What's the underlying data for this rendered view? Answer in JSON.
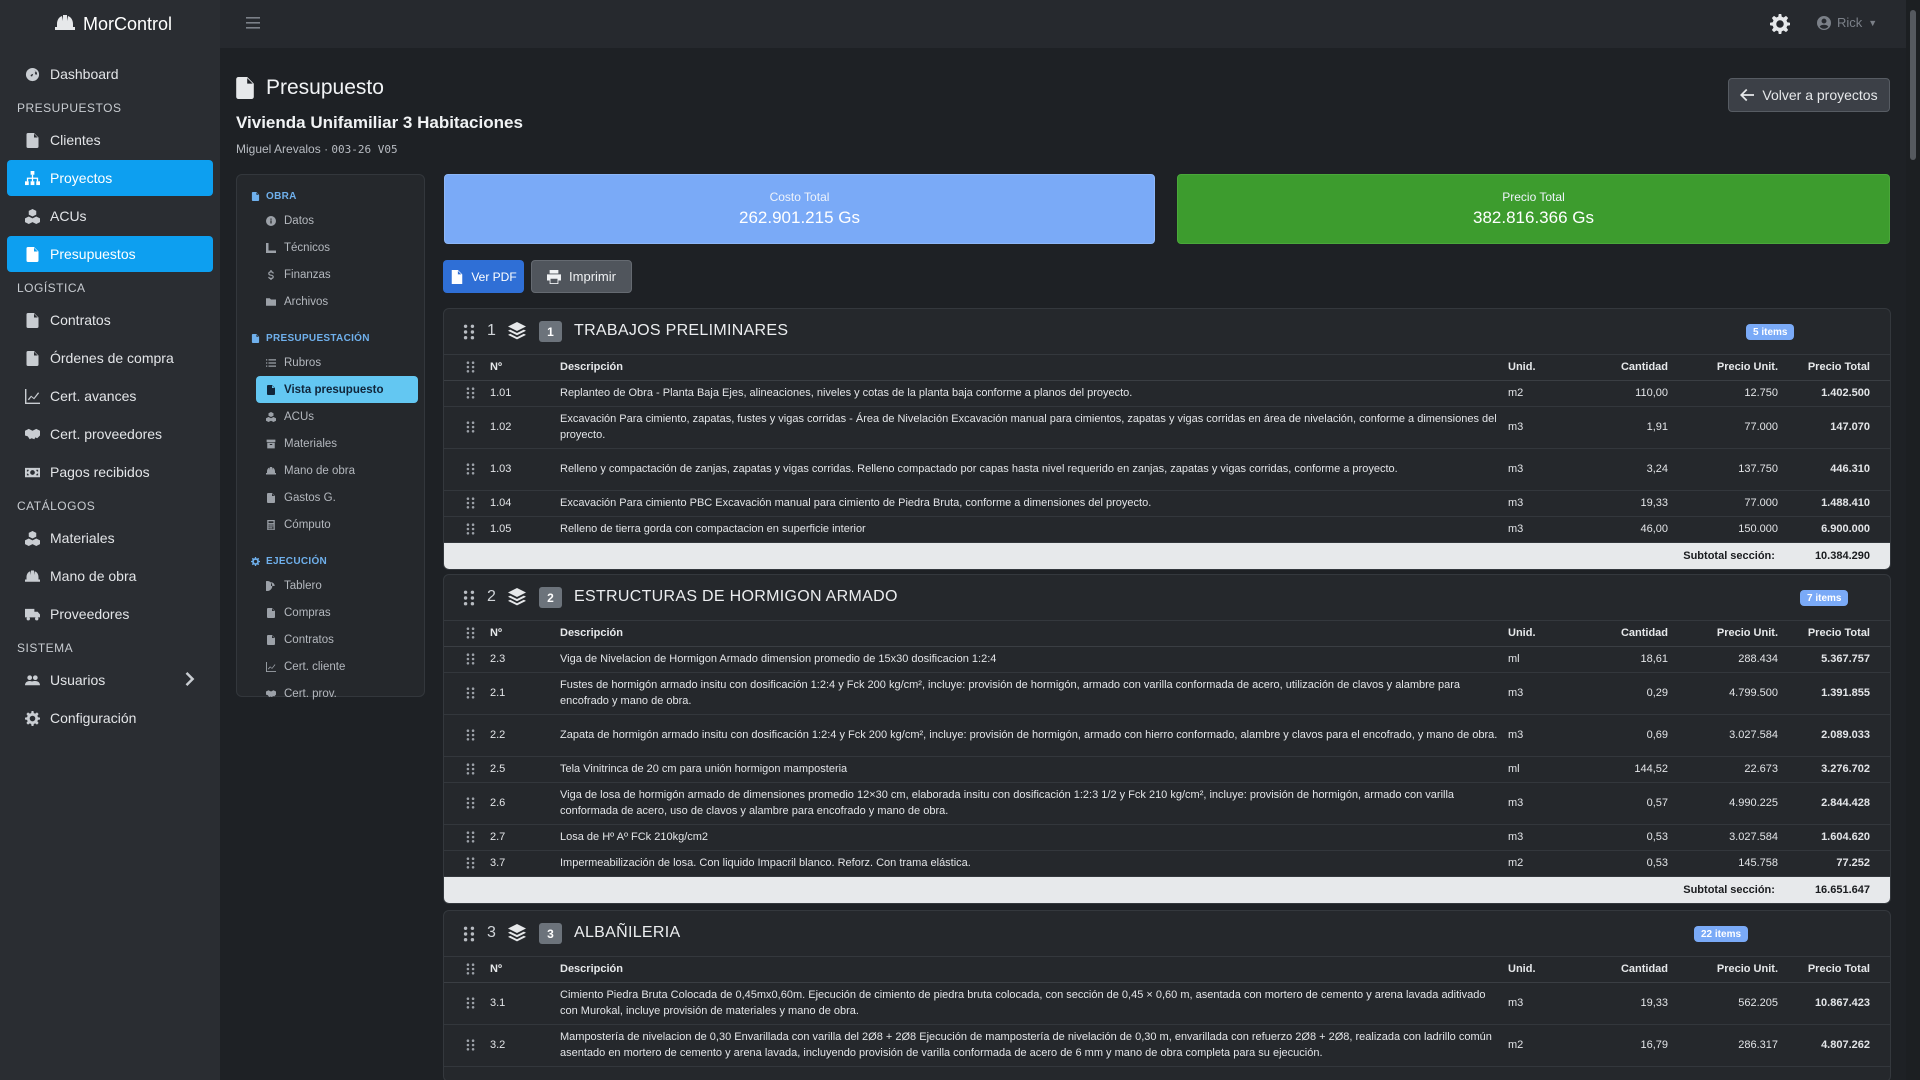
{
  "app": {
    "name": "MorControl"
  },
  "topbar": {
    "user": "Rick"
  },
  "sidebar": {
    "dashboard": "Dashboard",
    "sections": {
      "presupuestos": "PRESUPUESTOS",
      "logistica": "LOGÍSTICA",
      "catalogos": "CATÁLOGOS",
      "sistema": "SISTEMA"
    },
    "presupuestos_items": [
      "Clientes",
      "Proyectos",
      "ACUs",
      "Presupuestos"
    ],
    "logistica_items": [
      "Contratos",
      "Órdenes de compra",
      "Cert. avances",
      "Cert. proveedores",
      "Pagos recibidos"
    ],
    "catalogos_items": [
      "Materiales",
      "Mano de obra",
      "Proveedores"
    ],
    "sistema_items": [
      "Usuarios",
      "Configuración"
    ]
  },
  "page": {
    "title": "Presupuesto",
    "project": "Vivienda Unifamiliar 3 Habitaciones",
    "client": "Miguel Arevalos",
    "separator": "·",
    "code": "003-26 V05",
    "back_label": "Volver a proyectos"
  },
  "subnav": {
    "obra": {
      "label": "OBRA",
      "items": [
        "Datos",
        "Técnicos",
        "Finanzas",
        "Archivos"
      ]
    },
    "presupuestacion": {
      "label": "PRESUPUESTACIÓN",
      "items": [
        "Rubros",
        "Vista presupuesto",
        "ACUs",
        "Materiales",
        "Mano de obra",
        "Gastos G.",
        "Cómputo"
      ]
    },
    "ejecucion": {
      "label": "EJECUCIÓN",
      "items": [
        "Tablero",
        "Compras",
        "Contratos",
        "Cert. cliente",
        "Cert. prov."
      ]
    }
  },
  "kpis": {
    "cost_label": "Costo Total",
    "cost_value": "262.901.215 Gs",
    "price_label": "Precio Total",
    "price_value": "382.816.366 Gs"
  },
  "actions": {
    "pdf": "Ver PDF",
    "print": "Imprimir"
  },
  "columns": {
    "num": "Nº",
    "desc": "Descripción",
    "unit": "Unid.",
    "qty": "Cantidad",
    "unit_price": "Precio Unit.",
    "total": "Precio Total"
  },
  "subtotal_label": "Subtotal sección:",
  "sections": [
    {
      "index": "1",
      "code": "1",
      "title": "TRABAJOS PRELIMINARES",
      "badge": "5 items",
      "subtotal": "10.384.290",
      "rows": [
        {
          "n": "1.01",
          "d": "Replanteo de Obra - Planta Baja Ejes, alineaciones, niveles y cotas de la planta baja conforme a planos del proyecto.",
          "u": "m2",
          "q": "110,00",
          "p": "12.750",
          "t": "1.402.500"
        },
        {
          "n": "1.02",
          "d": "Excavación Para cimiento, zapatas, fustes y vigas corridas - Área de Nivelación Excavación manual para cimientos, zapatas y vigas corridas en área de nivelación, conforme a dimensiones del proyecto.",
          "u": "m3",
          "q": "1,91",
          "p": "77.000",
          "t": "147.070"
        },
        {
          "n": "1.03",
          "d": "Relleno y compactación de zanjas, zapatas y vigas corridas. Relleno compactado por capas hasta nivel requerido en zanjas, zapatas y vigas corridas, conforme a proyecto.",
          "u": "m3",
          "q": "3,24",
          "p": "137.750",
          "t": "446.310"
        },
        {
          "n": "1.04",
          "d": "Excavación Para cimiento PBC Excavación manual para cimiento de Piedra Bruta, conforme a dimensiones del proyecto.",
          "u": "m3",
          "q": "19,33",
          "p": "77.000",
          "t": "1.488.410"
        },
        {
          "n": "1.05",
          "d": "Relleno de tierra gorda con compactacion en superficie interior",
          "u": "m3",
          "q": "46,00",
          "p": "150.000",
          "t": "6.900.000"
        }
      ]
    },
    {
      "index": "2",
      "code": "2",
      "title": "ESTRUCTURAS DE HORMIGON ARMADO",
      "badge": "7 items",
      "subtotal": "16.651.647",
      "rows": [
        {
          "n": "2.3",
          "d": "Viga de Nivelacion de Hormigon Armado dimension promedio de 15x30 dosificacion 1:2:4",
          "u": "ml",
          "q": "18,61",
          "p": "288.434",
          "t": "5.367.757"
        },
        {
          "n": "2.1",
          "d": "Fustes de hormigón armado insitu con dosificación 1:2:4 y Fck 200 kg/cm², incluye: provisión de hormigón, armado con varilla conformada de acero, utilización de clavos y alambre para encofrado y mano de obra.",
          "u": "m3",
          "q": "0,29",
          "p": "4.799.500",
          "t": "1.391.855"
        },
        {
          "n": "2.2",
          "d": "Zapata de hormigón armado insitu con dosificación 1:2:4 y Fck 200 kg/cm², incluye: provisión de hormigón, armado con hierro conformado, alambre y clavos para el encofrado, y mano de obra.",
          "u": "m3",
          "q": "0,69",
          "p": "3.027.584",
          "t": "2.089.033"
        },
        {
          "n": "2.5",
          "d": "Tela Vinitrinca de 20 cm para unión hormigon mamposteria",
          "u": "ml",
          "q": "144,52",
          "p": "22.673",
          "t": "3.276.702"
        },
        {
          "n": "2.6",
          "d": "Viga de losa de hormigón armado de dimensiones promedio 12×30 cm, elaborada insitu con dosificación 1:2:3 1/2 y Fck 210 kg/cm², incluye: provisión de hormigón, armado con varilla conformada de acero, uso de clavos y alambre para encofrado y mano de obra.",
          "u": "m3",
          "q": "0,57",
          "p": "4.990.225",
          "t": "2.844.428"
        },
        {
          "n": "2.7",
          "d": "Losa de Hº Aº FCk 210kg/cm2",
          "u": "m3",
          "q": "0,53",
          "p": "3.027.584",
          "t": "1.604.620"
        },
        {
          "n": "3.7",
          "d": "Impermeabilización de losa. Con liquido Impacril blanco. Reforz. Con trama elástica.",
          "u": "m2",
          "q": "0,53",
          "p": "145.758",
          "t": "77.252"
        }
      ]
    },
    {
      "index": "3",
      "code": "3",
      "title": "ALBAÑILERIA",
      "badge": "22 items",
      "subtotal": "",
      "rows": [
        {
          "n": "3.1",
          "d": "Cimiento Piedra Bruta Colocada de 0,45mx0,60m. Ejecución de cimiento de piedra bruta colocada, con sección de 0,45 × 0,60 m, asentada con mortero de cemento y arena lavada aditivado con Murokal, incluye provisión de materiales y mano de obra.",
          "u": "m3",
          "q": "19,33",
          "p": "562.205",
          "t": "10.867.423"
        },
        {
          "n": "3.2",
          "d": "Mampostería de nivelacion de 0,30 Envarillada con varilla del 2Ø8 + 2Ø8 Ejecución de mampostería de nivelación de 0,30 m, envarillada con refuerzo 2Ø8 + 2Ø8, realizada con ladrillo común asentado en mortero de cemento y arena lavada, incluyendo provisión de varilla conformada de acero de 6 mm y mano de obra completa para su ejecución.",
          "u": "m2",
          "q": "16,79",
          "p": "286.317",
          "t": "4.807.262"
        }
      ]
    }
  ]
}
